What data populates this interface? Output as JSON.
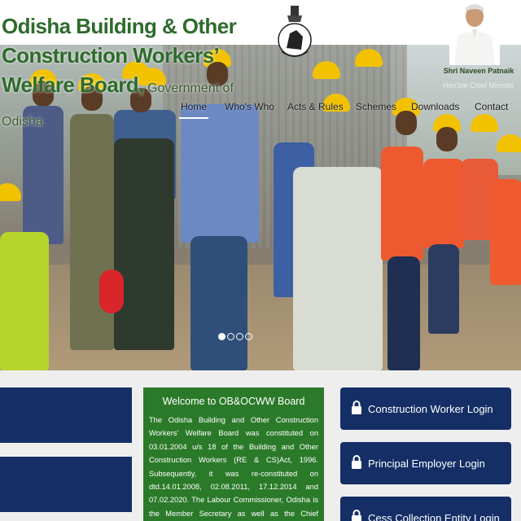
{
  "header": {
    "title_line1": "Odisha Building & Other Construction Workers’",
    "title_line2": "Welfare Board,",
    "title_suffix": " Government of Odisha",
    "cm_name": "Shri Naveen Patnaik",
    "cm_role": "Hon'ble Chief Minister",
    "accent_color": "#2e6b2c"
  },
  "nav": {
    "items": [
      "Home",
      "Who's Who",
      "Acts & Rules",
      "Schemes",
      "Downloads",
      "Contact"
    ]
  },
  "slider": {
    "total": 4,
    "active": 1
  },
  "welcome": {
    "title": "Welcome to OB&OCWW Board",
    "body": "The Odisha Building and Other Construction Workers' Welfare Board was constituted on 03.01.2004 u/s 18 of the Building and Other Construction Workers (RE & CS)Act, 1996. Subsequently, it was re-constituted on dtd.14.01.2008, 02.08.2011, 17.12.2014 and 07.02.2020. The Labour Commissioner, Odisha is the Member Secretary as well as the Chief Executive Officer of the"
  },
  "logins": {
    "construction_worker": "Construction Worker Login",
    "principal_employer": "Principal Employer Login",
    "cess_collection": "Cess Collection Entity Login"
  },
  "colors": {
    "navy": "#152f66",
    "green_panel": "#2b7a2a",
    "helmet": "#f2c200"
  }
}
